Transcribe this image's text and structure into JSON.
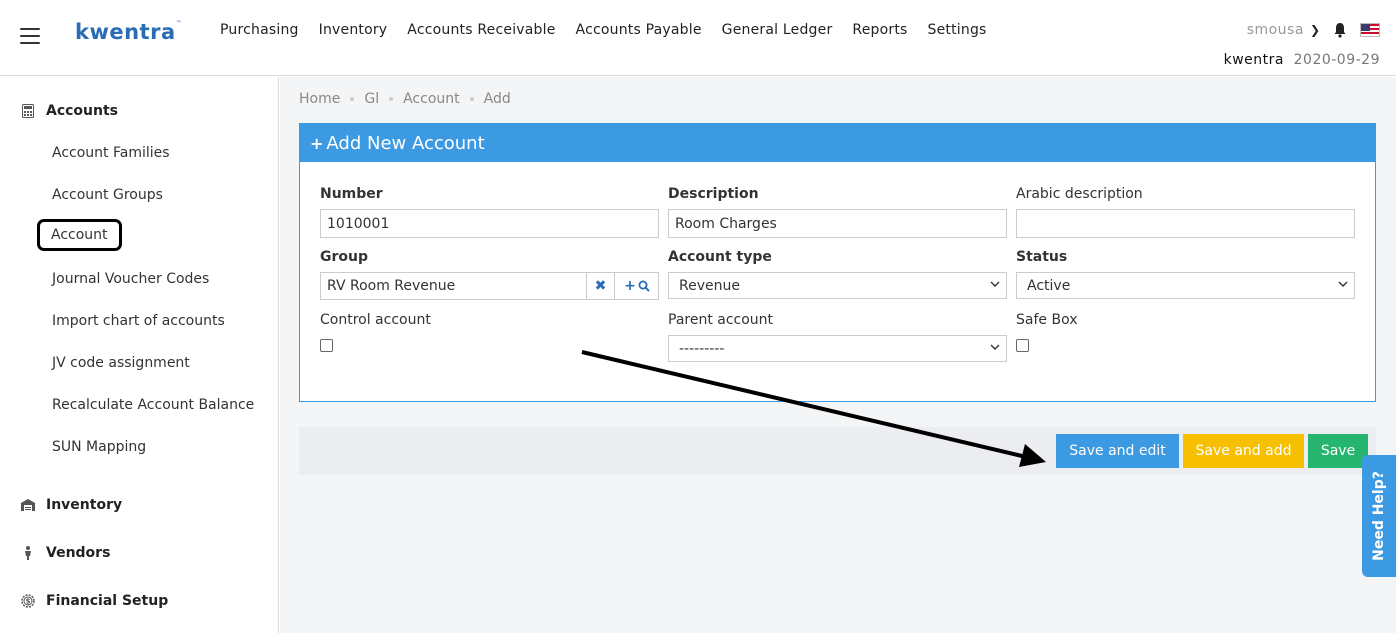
{
  "header": {
    "logo": "kwentra",
    "logo_tm": "™",
    "nav": [
      "Purchasing",
      "Inventory",
      "Accounts Receivable",
      "Accounts Payable",
      "General Ledger",
      "Reports",
      "Settings"
    ],
    "username": "smousa",
    "company": "kwentra",
    "date": "2020-09-29"
  },
  "sidebar": {
    "sections": [
      {
        "label": "Accounts",
        "icon": "calculator-icon"
      },
      {
        "label": "Inventory",
        "icon": "warehouse-icon"
      },
      {
        "label": "Vendors",
        "icon": "person-icon"
      },
      {
        "label": "Financial Setup",
        "icon": "dollar-gear-icon"
      }
    ],
    "items": [
      "Account Families",
      "Account Groups",
      "Account",
      "Journal Voucher Codes",
      "Import chart of accounts",
      "JV code assignment",
      "Recalculate Account Balance",
      "SUN Mapping"
    ],
    "active_item": "Account"
  },
  "breadcrumb": [
    "Home",
    "Gl",
    "Account",
    "Add"
  ],
  "panel": {
    "title": "Add New Account",
    "fields": {
      "number": {
        "label": "Number",
        "value": "1010001"
      },
      "description": {
        "label": "Description",
        "value": "Room Charges"
      },
      "arabic": {
        "label": "Arabic description",
        "value": ""
      },
      "group": {
        "label": "Group",
        "value": "RV Room Revenue"
      },
      "account_type": {
        "label": "Account type",
        "value": "Revenue"
      },
      "status": {
        "label": "Status",
        "value": "Active"
      },
      "control": {
        "label": "Control account",
        "checked": false
      },
      "parent": {
        "label": "Parent account",
        "value": "---------"
      },
      "safebox": {
        "label": "Safe Box",
        "checked": false
      }
    }
  },
  "actions": {
    "save_edit": "Save and edit",
    "save_add": "Save and add",
    "save": "Save"
  },
  "help": "Need Help?",
  "colors": {
    "brand_blue": "#3b9ae1",
    "save_add_yellow": "#f6c000",
    "save_green": "#26b56e"
  }
}
